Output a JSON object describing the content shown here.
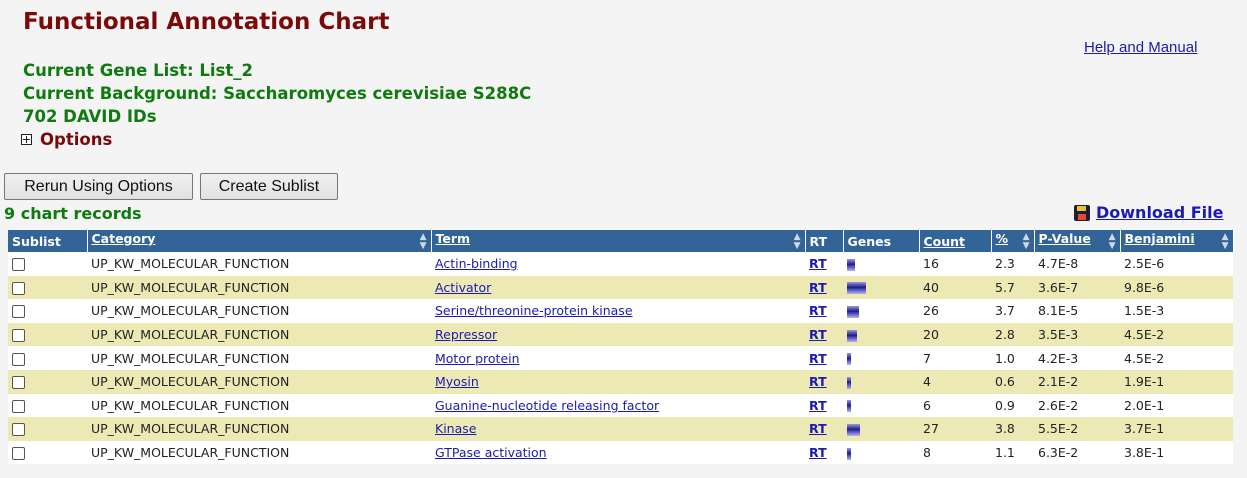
{
  "page": {
    "title": "Functional Annotation Chart",
    "help_link": "Help and Manual",
    "gene_list": "Current Gene List: List_2",
    "background": "Current Background: Saccharomyces cerevisiae S288C",
    "david_ids": "702 DAVID IDs",
    "options_label": "Options"
  },
  "buttons": {
    "rerun": "Rerun Using Options",
    "create_sublist": "Create Sublist"
  },
  "records_label": "9 chart records",
  "download_label": "Download File",
  "table": {
    "headers": {
      "sublist": "Sublist",
      "category": "Category",
      "term": "Term",
      "rt": "RT",
      "genes": "Genes",
      "count": "Count",
      "percent": "%",
      "pvalue": "P-Value",
      "benjamini": "Benjamini"
    },
    "rows": [
      {
        "category": "UP_KW_MOLECULAR_FUNCTION",
        "term": "Actin-binding",
        "rt": "RT",
        "count": "16",
        "percent": "2.3",
        "pvalue": "4.7E-8",
        "benjamini": "2.5E-6"
      },
      {
        "category": "UP_KW_MOLECULAR_FUNCTION",
        "term": "Activator",
        "rt": "RT",
        "count": "40",
        "percent": "5.7",
        "pvalue": "3.6E-7",
        "benjamini": "9.8E-6"
      },
      {
        "category": "UP_KW_MOLECULAR_FUNCTION",
        "term": "Serine/threonine-protein kinase",
        "rt": "RT",
        "count": "26",
        "percent": "3.7",
        "pvalue": "8.1E-5",
        "benjamini": "1.5E-3"
      },
      {
        "category": "UP_KW_MOLECULAR_FUNCTION",
        "term": "Repressor",
        "rt": "RT",
        "count": "20",
        "percent": "2.8",
        "pvalue": "3.5E-3",
        "benjamini": "4.5E-2"
      },
      {
        "category": "UP_KW_MOLECULAR_FUNCTION",
        "term": "Motor protein",
        "rt": "RT",
        "count": "7",
        "percent": "1.0",
        "pvalue": "4.2E-3",
        "benjamini": "4.5E-2"
      },
      {
        "category": "UP_KW_MOLECULAR_FUNCTION",
        "term": "Myosin",
        "rt": "RT",
        "count": "4",
        "percent": "0.6",
        "pvalue": "2.1E-2",
        "benjamini": "1.9E-1"
      },
      {
        "category": "UP_KW_MOLECULAR_FUNCTION",
        "term": "Guanine-nucleotide releasing factor",
        "rt": "RT",
        "count": "6",
        "percent": "0.9",
        "pvalue": "2.6E-2",
        "benjamini": "2.0E-1"
      },
      {
        "category": "UP_KW_MOLECULAR_FUNCTION",
        "term": "Kinase",
        "rt": "RT",
        "count": "27",
        "percent": "3.8",
        "pvalue": "5.5E-2",
        "benjamini": "3.7E-1"
      },
      {
        "category": "UP_KW_MOLECULAR_FUNCTION",
        "term": "GTPase activation",
        "rt": "RT",
        "count": "8",
        "percent": "1.1",
        "pvalue": "6.3E-2",
        "benjamini": "3.8E-1"
      }
    ]
  },
  "colors": {
    "title": "#7a0a0a",
    "info_green": "#0f7a0f",
    "header_bg": "#336497",
    "row_alt": "#ede9b5",
    "link": "#1b1bb0"
  }
}
